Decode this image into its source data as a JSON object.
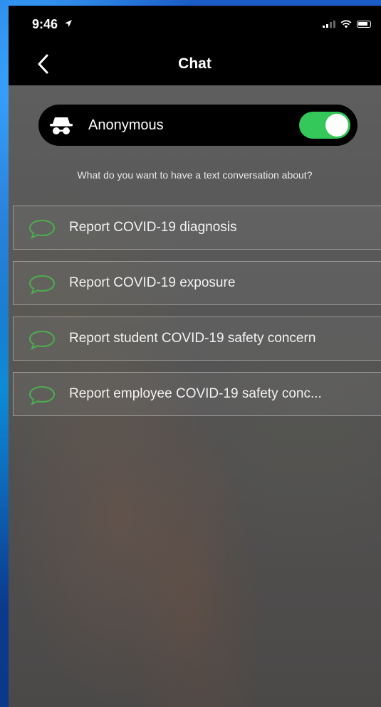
{
  "status_bar": {
    "time": "9:46"
  },
  "nav": {
    "title": "Chat",
    "back_icon": "chevron-left-icon"
  },
  "anonymous": {
    "label": "Anonymous",
    "icon": "incognito-spy-icon",
    "enabled": true,
    "accent_color": "#34c759"
  },
  "prompt": "What do you want to have a text conversation about?",
  "options": [
    {
      "label": "Report COVID-19 diagnosis",
      "icon": "chat-bubble-icon"
    },
    {
      "label": "Report COVID-19 exposure",
      "icon": "chat-bubble-icon"
    },
    {
      "label": "Report student COVID-19 safety concern",
      "icon": "chat-bubble-icon"
    },
    {
      "label": "Report employee COVID-19 safety conc...",
      "icon": "chat-bubble-icon"
    }
  ],
  "colors": {
    "icon_green": "#4cae4f",
    "header_bg": "#000000",
    "content_bg": "#5a5a5a"
  }
}
